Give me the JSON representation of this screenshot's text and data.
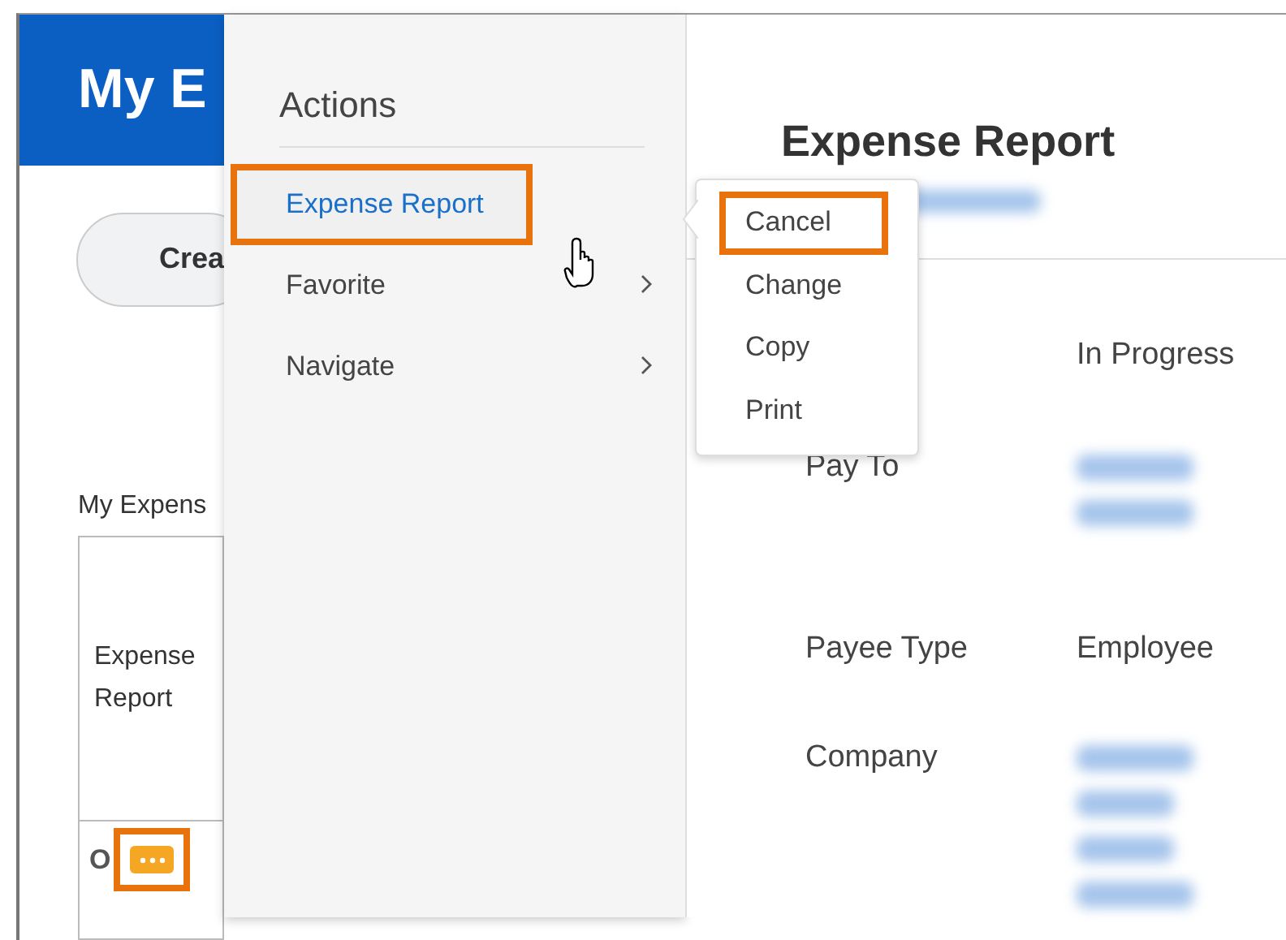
{
  "page": {
    "title": "My E",
    "create_button": "Crea",
    "section_title": "My Expens",
    "table": {
      "columns": [
        "Expense Report"
      ],
      "rows": [
        {
          "cell": "O",
          "action_highlighted": true
        }
      ]
    }
  },
  "actions_menu": {
    "title": "Actions",
    "items": [
      {
        "label": "Expense Report",
        "selected": true,
        "highlighted": true,
        "has_submenu": false
      },
      {
        "label": "Favorite",
        "selected": false,
        "highlighted": false,
        "has_submenu": true
      },
      {
        "label": "Navigate",
        "selected": false,
        "highlighted": false,
        "has_submenu": true
      }
    ]
  },
  "submenu": {
    "items": [
      {
        "label": "Cancel",
        "highlighted": true
      },
      {
        "label": "Change",
        "highlighted": false
      },
      {
        "label": "Copy",
        "highlighted": false
      },
      {
        "label": "Print",
        "highlighted": false
      }
    ]
  },
  "detail": {
    "title": "Expense Report",
    "fields": [
      {
        "kind": "text",
        "value": "In Progress"
      },
      {
        "kind": "redacted",
        "label": "Pay To"
      },
      {
        "kind": "text",
        "label": "Payee Type",
        "value": "Employee"
      },
      {
        "kind": "redacted_block",
        "label": "Company"
      }
    ]
  }
}
